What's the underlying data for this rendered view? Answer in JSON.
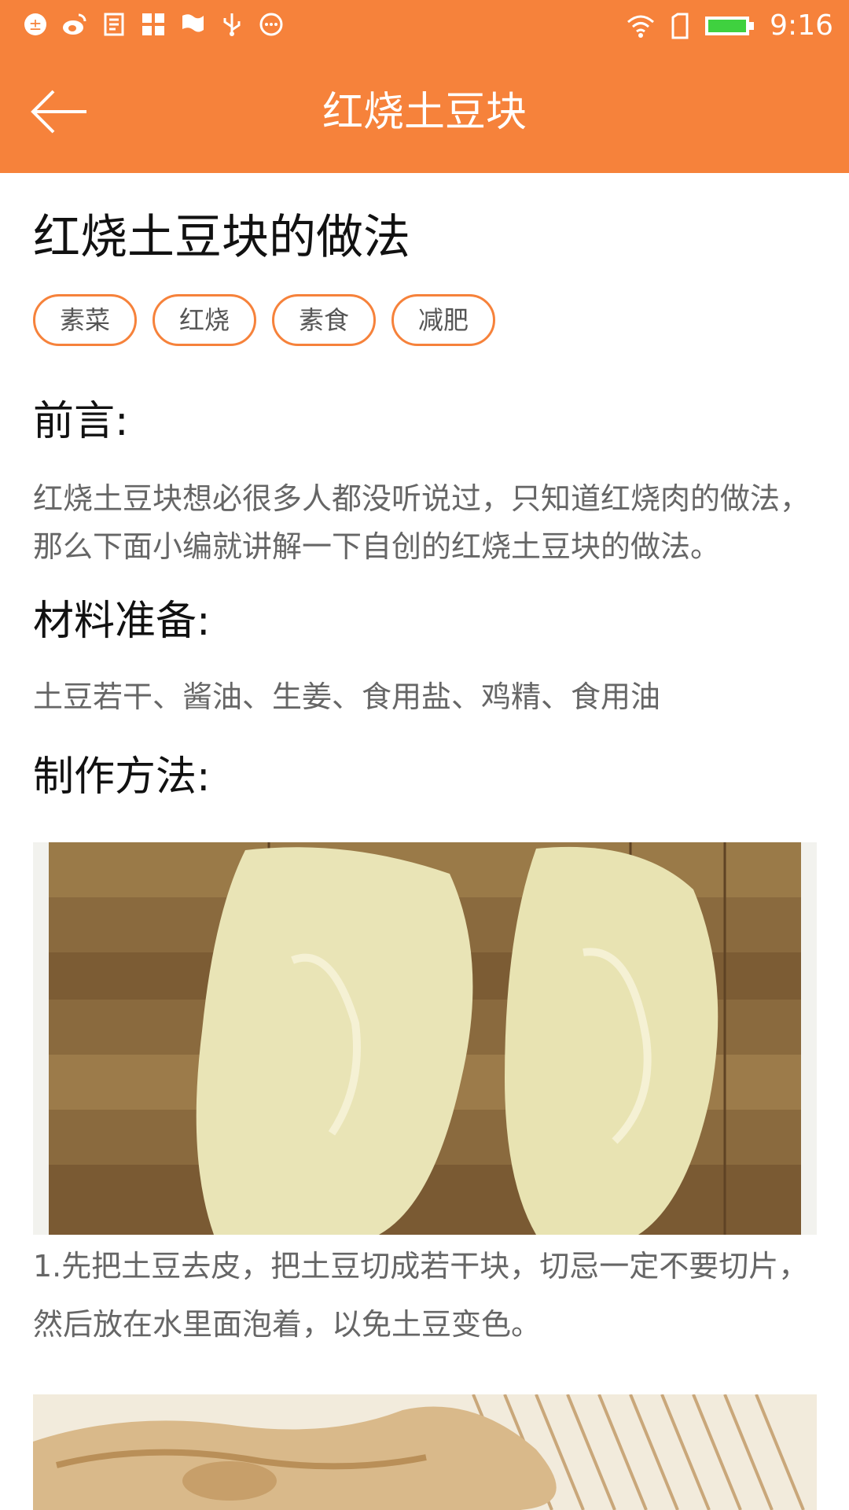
{
  "status_bar": {
    "icons": [
      "sync-icon",
      "weibo-icon",
      "notes-icon",
      "apps-icon",
      "flag-icon",
      "usb-icon",
      "more-dots-icon",
      "wifi-icon",
      "sim-icon",
      "battery-icon"
    ],
    "time": "9:16"
  },
  "app_bar": {
    "title": "红烧土豆块",
    "back_icon": "arrow-left-icon",
    "color": "#F6823B"
  },
  "article": {
    "title": "红烧土豆块的做法",
    "tags": [
      "素菜",
      "红烧",
      "素食",
      "减肥"
    ],
    "intro_heading": "前言:",
    "intro_text": "红烧土豆块想必很多人都没听说过，只知道红烧肉的做法，那么下面小编就讲解一下自创的红烧土豆块的做法。",
    "ingredients_heading": "材料准备:",
    "ingredients_text": "土豆若干、酱油、生姜、食用盐、鸡精、食用油",
    "method_heading": "制作方法:",
    "steps": [
      {
        "image": "peeled-potatoes-photo",
        "text": "1.先把土豆去皮，把土豆切成若干块，切忌一定不要切片，然后放在水里面泡着，以免土豆变色。"
      },
      {
        "image": "ginger-photo"
      }
    ]
  }
}
